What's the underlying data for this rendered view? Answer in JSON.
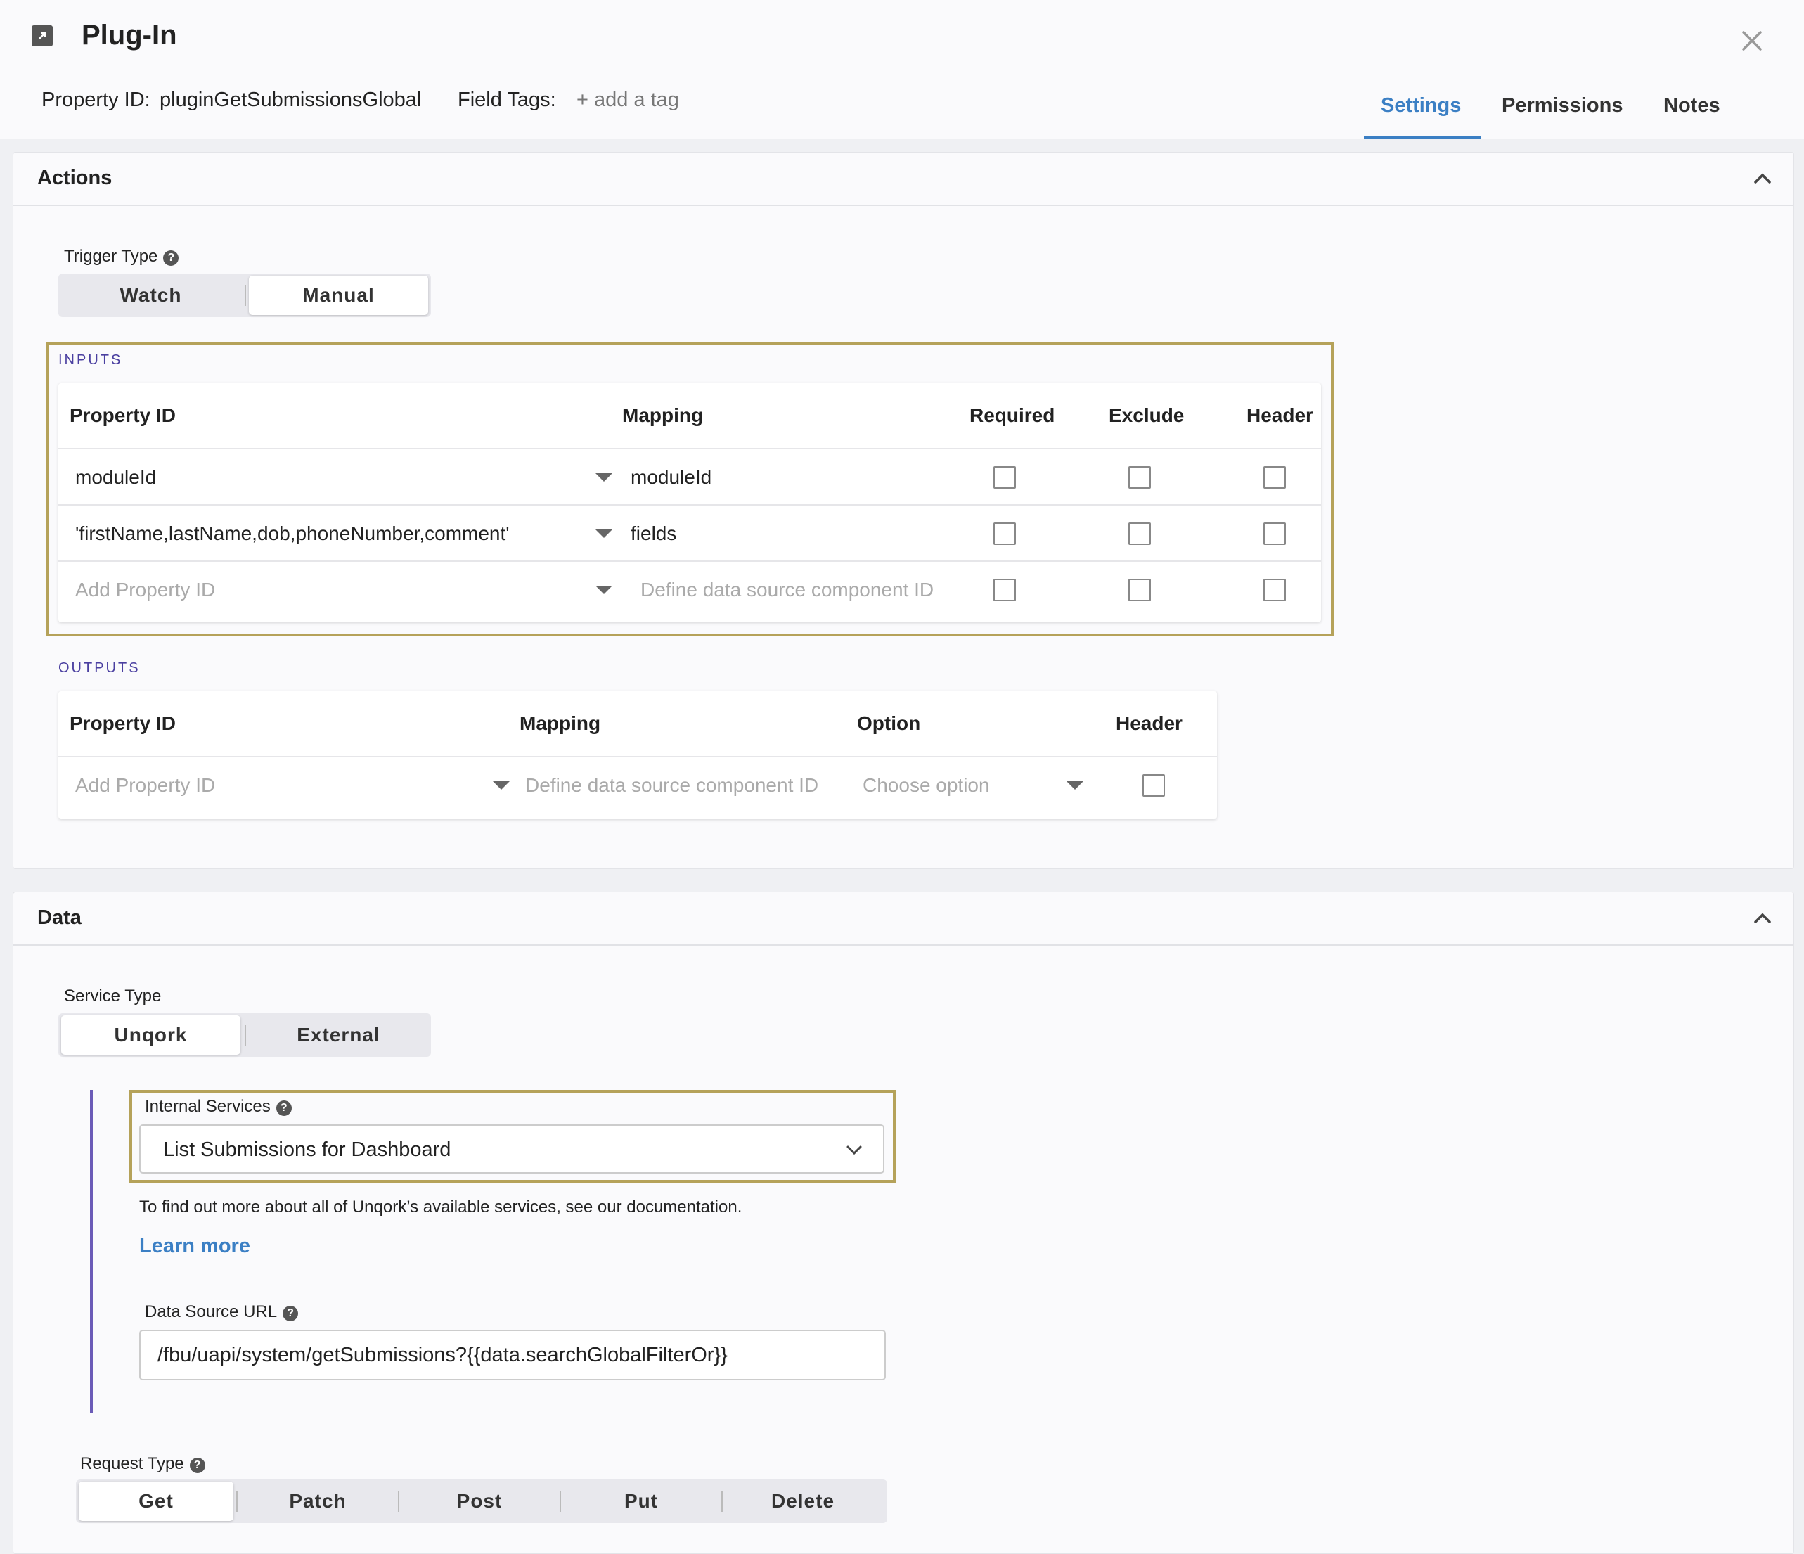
{
  "header": {
    "title": "Plug-In",
    "property_id_label": "Property ID:",
    "property_id_value": "pluginGetSubmissionsGlobal",
    "field_tags_label": "Field Tags:",
    "add_tag": "+ add a tag",
    "tabs": [
      "Settings",
      "Permissions",
      "Notes"
    ],
    "active_tab": "Settings"
  },
  "actions": {
    "title": "Actions",
    "trigger_type_label": "Trigger Type",
    "trigger_options": [
      "Watch",
      "Manual"
    ],
    "trigger_selected": "Manual",
    "inputs": {
      "caption": "INPUTS",
      "columns": [
        "Property ID",
        "Mapping",
        "Required",
        "Exclude",
        "Header"
      ],
      "rows": [
        {
          "property_id": "moduleId",
          "mapping": "moduleId",
          "required": false,
          "exclude": false,
          "header": false
        },
        {
          "property_id": "'firstName,lastName,dob,phoneNumber,comment'",
          "mapping": "fields",
          "required": false,
          "exclude": false,
          "header": false
        }
      ],
      "new_row": {
        "property_placeholder": "Add Property ID",
        "mapping_placeholder": "Define data source component ID"
      }
    },
    "outputs": {
      "caption": "OUTPUTS",
      "columns": [
        "Property ID",
        "Mapping",
        "Option",
        "Header"
      ],
      "new_row": {
        "property_placeholder": "Add Property ID",
        "mapping_placeholder": "Define data source component ID",
        "option_placeholder": "Choose option"
      }
    }
  },
  "data": {
    "title": "Data",
    "service_type_label": "Service Type",
    "service_options": [
      "Unqork",
      "External"
    ],
    "service_selected": "Unqork",
    "internal_services_label": "Internal Services",
    "internal_service_value": "List Submissions for Dashboard",
    "doc_text": "To find out more about all of Unqork’s available services, see our documentation.",
    "learn_more": "Learn more",
    "data_source_url_label": "Data Source URL",
    "data_source_url": "/fbu/uapi/system/getSubmissions?{{data.searchGlobalFilterOr}}",
    "request_type_label": "Request Type",
    "request_options": [
      "Get",
      "Patch",
      "Post",
      "Put",
      "Delete"
    ],
    "request_selected": "Get"
  },
  "colors": {
    "accent": "#3b7fc4",
    "highlight": "#b5a25a",
    "section_caption": "#4a3fa0"
  }
}
